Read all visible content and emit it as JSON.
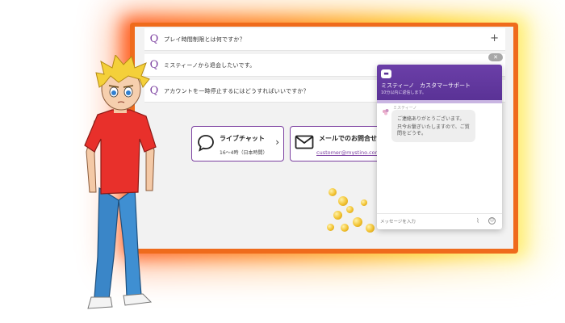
{
  "faq": [
    {
      "q": "Q",
      "text": "プレイ時間制限とは何ですか？",
      "expand": "+"
    },
    {
      "q": "Q",
      "text": "ミスティーノから退会したいです。"
    },
    {
      "q": "Q",
      "text": "アカウントを一時停止するにはどうすればいいですか？"
    }
  ],
  "contact": {
    "live_chat": {
      "title": "ライブチャット",
      "hours": "16〜4時（日本時間）",
      "chevron": "›"
    },
    "email": {
      "title": "メールでのお問合せ",
      "address": "customer@mystino.com"
    }
  },
  "close_label": "✕",
  "chat": {
    "title": "ミスティーノ　カスタマーサポート",
    "status": "10分以内に返信します。",
    "bot_name": "ミスティーノ",
    "messages": [
      "ご連絡ありがとうございます。",
      "只今お繋ぎいたしますので、ご質問をどうぞ。"
    ],
    "input_placeholder": "メッセージを入力",
    "icons": {
      "attach": "paperclip-icon",
      "emoji": "emoji-icon",
      "header": "chat-bubble-icon"
    }
  },
  "colors": {
    "accent": "#7b3fa0",
    "header": "#5a3296",
    "frame": "#ef6b1c",
    "glow": "#ffd21e"
  }
}
